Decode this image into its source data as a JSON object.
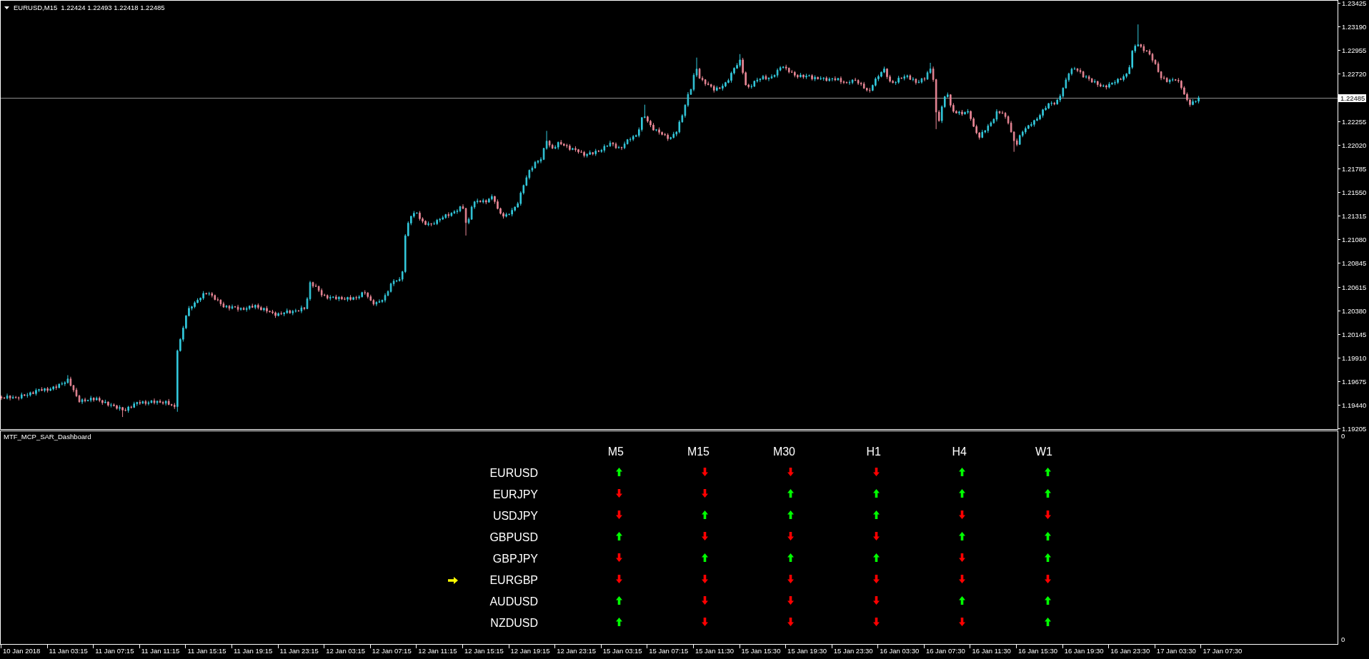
{
  "chart": {
    "header": {
      "symbol": "EURUSD,M15",
      "quote": "1.22424 1.22493 1.22418 1.22485"
    },
    "price_axis": [
      {
        "text": "1.23425",
        "kind": "tick"
      },
      {
        "text": "1.23190",
        "kind": "tick"
      },
      {
        "text": "1.22955",
        "kind": "tick"
      },
      {
        "text": "1.22720",
        "kind": "tick"
      },
      {
        "text": "1.22485",
        "kind": "current"
      },
      {
        "text": "1.22255",
        "kind": "tick"
      },
      {
        "text": "1.22020",
        "kind": "tick"
      },
      {
        "text": "1.21785",
        "kind": "tick"
      },
      {
        "text": "1.21550",
        "kind": "tick"
      },
      {
        "text": "1.21315",
        "kind": "tick"
      },
      {
        "text": "1.21080",
        "kind": "tick"
      },
      {
        "text": "1.20845",
        "kind": "tick"
      },
      {
        "text": "1.20615",
        "kind": "tick"
      },
      {
        "text": "1.20380",
        "kind": "tick"
      },
      {
        "text": "1.20145",
        "kind": "tick"
      },
      {
        "text": "1.19910",
        "kind": "tick"
      },
      {
        "text": "1.19675",
        "kind": "tick"
      },
      {
        "text": "1.19440",
        "kind": "tick"
      },
      {
        "text": "1.19205",
        "kind": "tick"
      }
    ]
  },
  "indicator": {
    "title": "MTF_MCP_SAR_Dashboard",
    "axis_labels": [
      "0",
      "0"
    ],
    "dashboard": {
      "columns": [
        "M5",
        "M15",
        "M30",
        "H1",
        "H4",
        "W1"
      ],
      "rows": [
        {
          "symbol": "EURUSD",
          "selected": false,
          "signals": [
            {
              "up": true
            },
            {
              "up": false
            },
            {
              "up": false
            },
            {
              "up": false
            },
            {
              "up": true
            },
            {
              "up": true
            }
          ]
        },
        {
          "symbol": "EURJPY",
          "selected": false,
          "signals": [
            {
              "up": false
            },
            {
              "up": false
            },
            {
              "up": true
            },
            {
              "up": true
            },
            {
              "up": true
            },
            {
              "up": true
            }
          ]
        },
        {
          "symbol": "USDJPY",
          "selected": false,
          "signals": [
            {
              "up": false
            },
            {
              "up": true
            },
            {
              "up": true
            },
            {
              "up": true
            },
            {
              "up": false
            },
            {
              "up": false
            }
          ]
        },
        {
          "symbol": "GBPUSD",
          "selected": false,
          "signals": [
            {
              "up": true
            },
            {
              "up": false
            },
            {
              "up": false
            },
            {
              "up": false
            },
            {
              "up": true
            },
            {
              "up": true
            }
          ]
        },
        {
          "symbol": "GBPJPY",
          "selected": false,
          "signals": [
            {
              "up": false
            },
            {
              "up": true
            },
            {
              "up": true
            },
            {
              "up": true
            },
            {
              "up": false
            },
            {
              "up": true
            }
          ]
        },
        {
          "symbol": "EURGBP",
          "selected": true,
          "signals": [
            {
              "up": false
            },
            {
              "up": false
            },
            {
              "up": false
            },
            {
              "up": false
            },
            {
              "up": false
            },
            {
              "up": false
            }
          ]
        },
        {
          "symbol": "AUDUSD",
          "selected": false,
          "signals": [
            {
              "up": true
            },
            {
              "up": false
            },
            {
              "up": false
            },
            {
              "up": false
            },
            {
              "up": true
            },
            {
              "up": true
            }
          ]
        },
        {
          "symbol": "NZDUSD",
          "selected": false,
          "signals": [
            {
              "up": true
            },
            {
              "up": false
            },
            {
              "up": false
            },
            {
              "up": false
            },
            {
              "up": false
            },
            {
              "up": true
            }
          ]
        }
      ]
    }
  },
  "time_axis": [
    "10 Jan 2018",
    "11 Jan 03:15",
    "11 Jan 07:15",
    "11 Jan 11:15",
    "11 Jan 15:15",
    "11 Jan 19:15",
    "11 Jan 23:15",
    "12 Jan 03:15",
    "12 Jan 07:15",
    "12 Jan 11:15",
    "12 Jan 15:15",
    "12 Jan 19:15",
    "12 Jan 23:15",
    "15 Jan 03:15",
    "15 Jan 07:15",
    "15 Jan 11:30",
    "15 Jan 15:30",
    "15 Jan 19:30",
    "15 Jan 23:30",
    "16 Jan 03:30",
    "16 Jan 07:30",
    "16 Jan 11:30",
    "16 Jan 15:30",
    "16 Jan 19:30",
    "16 Jan 23:30",
    "17 Jan 03:30",
    "17 Jan 07:30"
  ]
}
